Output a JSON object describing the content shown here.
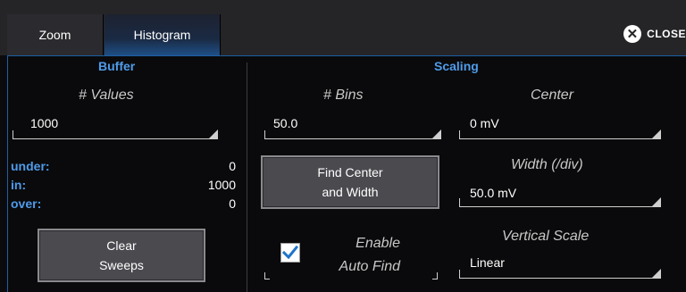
{
  "tabs": {
    "zoom": "Zoom",
    "histogram": "Histogram"
  },
  "close": {
    "label": "CLOSE",
    "icon": "close-circle-icon"
  },
  "buffer": {
    "title": "Buffer",
    "values_label": "# Values",
    "values_value": "1000",
    "stats": [
      {
        "label": "under:",
        "value": "0"
      },
      {
        "label": "in:",
        "value": "1000"
      },
      {
        "label": "over:",
        "value": "0"
      }
    ],
    "clear_button": {
      "line1": "Clear",
      "line2": "Sweeps"
    }
  },
  "scaling": {
    "title": "Scaling",
    "bins_label": "# Bins",
    "bins_value": "50.0",
    "center_label": "Center",
    "center_value": "0 mV",
    "find_button": {
      "line1": "Find Center",
      "line2": "and Width"
    },
    "width_label": "Width (/div)",
    "width_value": "50.0 mV",
    "enable_label_1": "Enable",
    "enable_label_2": "Auto Find",
    "enable_checked": true,
    "vscale_label": "Vertical Scale",
    "vscale_value": "Linear"
  },
  "colors": {
    "accent": "#4f9bea",
    "tab_active": "#1e4f86",
    "panel_border": "#1c5fa3",
    "check": "#1f74c8"
  }
}
